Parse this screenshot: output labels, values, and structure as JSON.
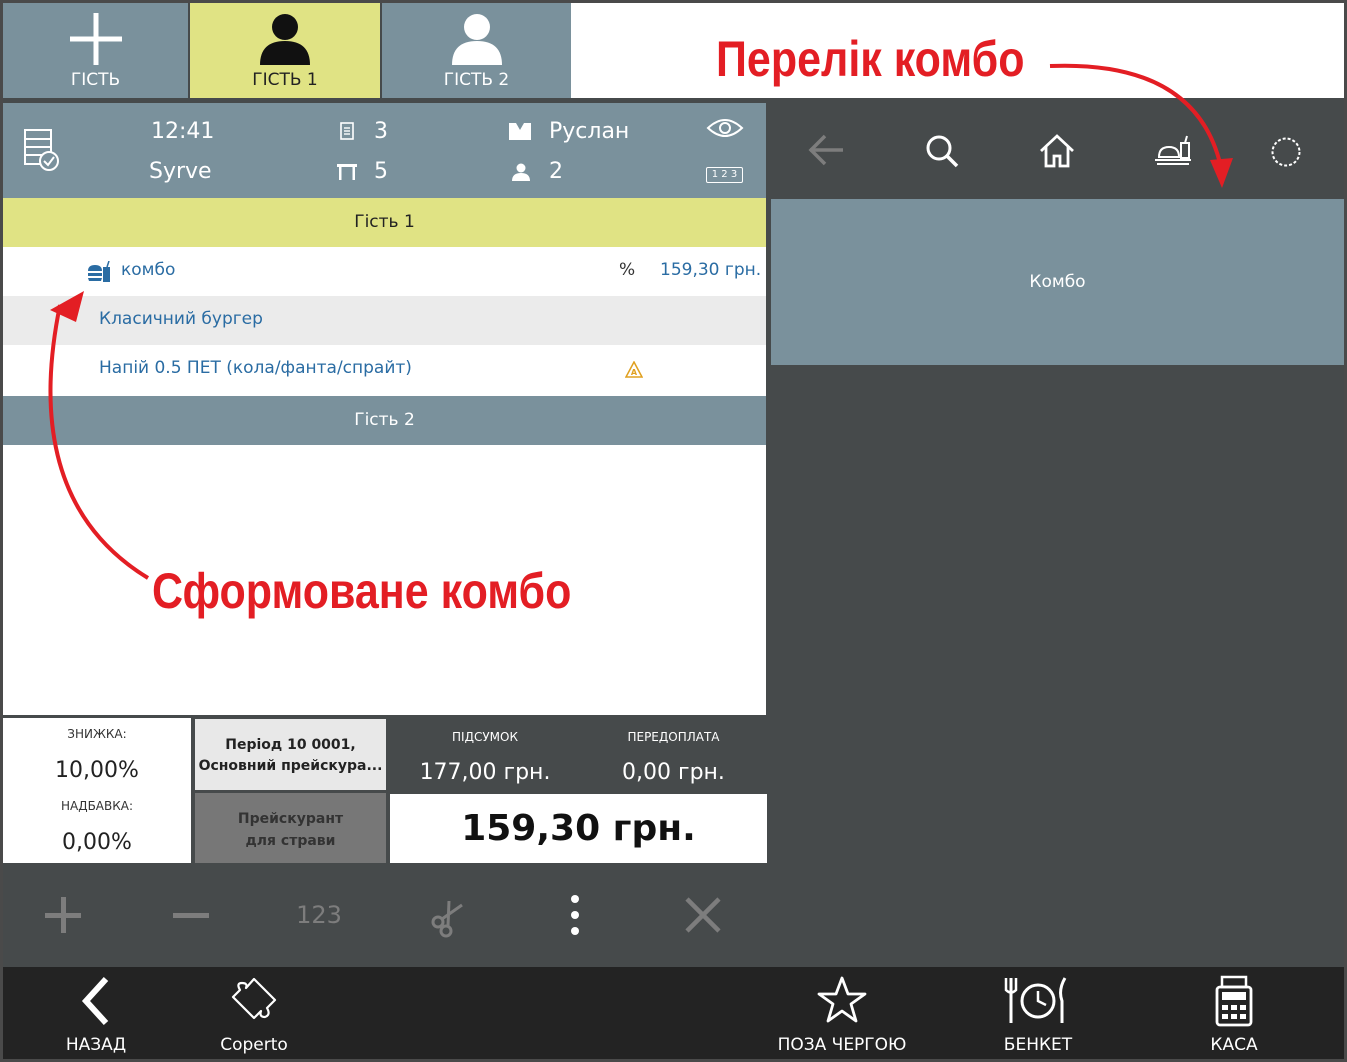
{
  "guest_tabs": {
    "add_label": "ГІСТЬ",
    "guest1_label": "ГІСТЬ 1",
    "guest2_label": "ГІСТЬ 2"
  },
  "order_header": {
    "time": "12:41",
    "waiter_group": "Syrve",
    "order_number": "3",
    "table_number": "5",
    "waiter_name": "Руслан",
    "guests_count": "2",
    "numeric_badge": "1 2 3"
  },
  "order": {
    "guest1_header": "Гість 1",
    "combo": {
      "name": "комбо",
      "discount_mark": "%",
      "price": "159,30 грн."
    },
    "items": [
      {
        "name": "Класичний бургер"
      },
      {
        "name": "Напій 0.5 ПЕТ (кола/фанта/спрайт)"
      }
    ],
    "guest2_header": "Гість 2"
  },
  "totals": {
    "discount_label": "ЗНИЖКА:",
    "discount_value": "10,00%",
    "surcharge_label": "НАДБАВКА:",
    "surcharge_value": "0,00%",
    "pricelist_line1": "Період 10 0001,",
    "pricelist_line2": "Основний прейскура...",
    "dish_pricelist_line1": "Прейскурант",
    "dish_pricelist_line2": "для страви",
    "subtotal_label": "ПІДСУМОК",
    "subtotal_value": "177,00 грн.",
    "prepay_label": "ПЕРЕДОПЛАТА",
    "prepay_value": "0,00 грн.",
    "grand_total": "159,30 грн."
  },
  "toolbar": {
    "numeric_label": "123"
  },
  "menu": {
    "combo_button": "Комбо"
  },
  "bottom_nav": {
    "back": "НАЗАД",
    "coperto": "Coperto",
    "out_of_turn": "ПОЗА ЧЕРГОЮ",
    "banquet": "БЕНКЕТ",
    "cash": "КАСА"
  },
  "annotations": {
    "combo_list": "Перелік комбо",
    "formed_combo": "Сформоване комбо"
  },
  "colors": {
    "slate": "#7a919c",
    "guest_yellow": "#e0e384",
    "dark_bg": "#464a4b",
    "nav_bg": "#232323",
    "item_blue": "#2a6ca3",
    "annotation_red": "#e31e24"
  }
}
